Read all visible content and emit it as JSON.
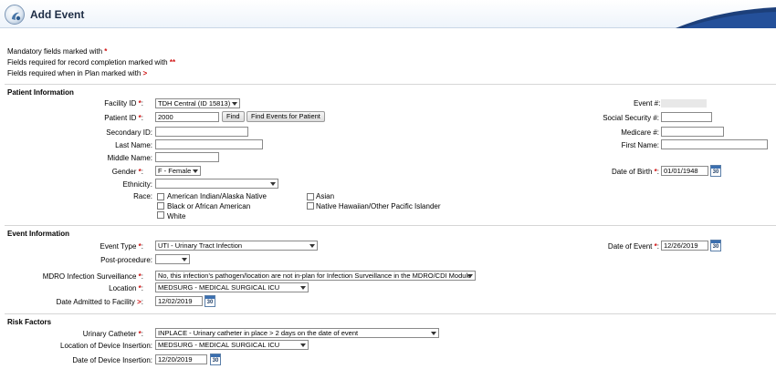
{
  "header": {
    "title": "Add Event"
  },
  "legend": {
    "mandatory": "Mandatory fields marked with",
    "mandatory_marker": "*",
    "completion": "Fields required for record completion marked with",
    "completion_marker": "**",
    "plan": "Fields required when in Plan marked with",
    "plan_marker": ">"
  },
  "patient": {
    "section_title": "Patient Information",
    "facility_label": "Facility ID",
    "facility_value": "TDH Central (ID 15813)",
    "patient_id_label": "Patient ID",
    "patient_id_value": "2000",
    "find_button": "Find",
    "find_events_button": "Find Events for Patient",
    "secondary_id_label": "Secondary ID:",
    "secondary_id_value": "",
    "last_name_label": "Last Name:",
    "last_name_value": "",
    "middle_name_label": "Middle Name:",
    "middle_name_value": "",
    "gender_label": "Gender",
    "gender_value": "F - Female",
    "ethnicity_label": "Ethnicity:",
    "ethnicity_value": "",
    "race_label": "Race:",
    "race_options": [
      "American Indian/Alaska Native",
      "Black or African American",
      "White",
      "Asian",
      "Native Hawaiian/Other Pacific Islander"
    ],
    "event_num_label": "Event #:",
    "ssn_label": "Social Security #:",
    "ssn_value": "",
    "medicare_label": "Medicare #:",
    "medicare_value": "",
    "first_name_label": "First Name:",
    "first_name_value": "",
    "dob_label": "Date of Birth",
    "dob_value": "01/01/1948"
  },
  "event": {
    "section_title": "Event Information",
    "event_type_label": "Event Type",
    "event_type_value": "UTI - Urinary Tract Infection",
    "post_procedure_label": "Post-procedure:",
    "post_procedure_value": "",
    "mdro_label": "MDRO Infection Surveillance",
    "mdro_value": "No, this infection's pathogen/location are not in-plan for Infection Surveillance in the MDRO/CDI Module",
    "location_label": "Location",
    "location_value": "MEDSURG - MEDICAL SURGICAL ICU",
    "admitted_label": "Date Admitted to Facility",
    "admitted_value": "12/02/2019",
    "date_of_event_label": "Date of Event",
    "date_of_event_value": "12/26/2019"
  },
  "risk": {
    "section_title": "Risk Factors",
    "catheter_label": "Urinary Catheter",
    "catheter_value": "INPLACE - Urinary catheter in place > 2 days on the date of event",
    "insertion_location_label": "Location of Device Insertion:",
    "insertion_location_value": "MEDSURG - MEDICAL SURGICAL ICU",
    "insertion_date_label": "Date of Device Insertion:",
    "insertion_date_value": "12/20/2019"
  },
  "calendar_icon_text": "30"
}
